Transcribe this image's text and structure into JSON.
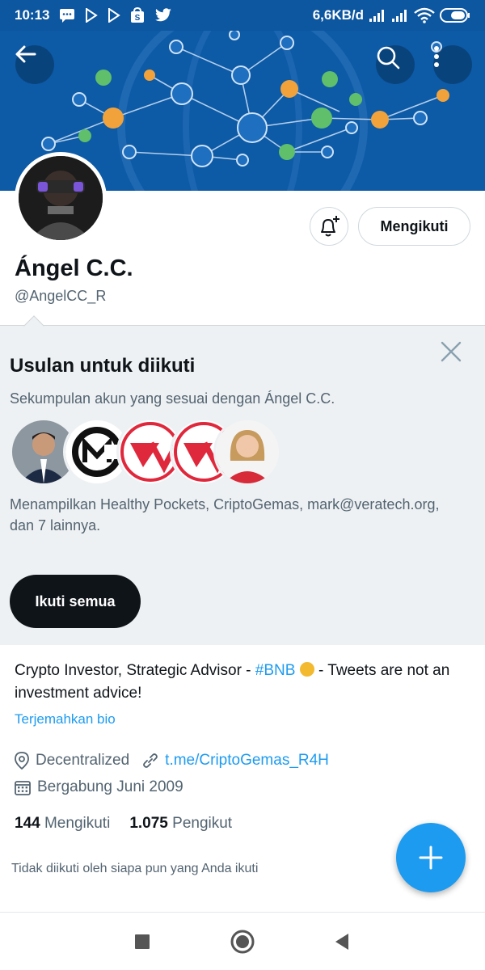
{
  "status_bar": {
    "time": "10:13",
    "network_speed": "6,6KB/d",
    "icons": [
      "chat-icon",
      "play-store-icon",
      "play-icon",
      "shop-icon",
      "twitter-icon",
      "signal-icon",
      "signal-icon",
      "wifi-icon",
      "battery-icon"
    ]
  },
  "header": {
    "back_icon": "arrow-left-icon",
    "search_icon": "search-icon",
    "more_icon": "more-vertical-icon"
  },
  "profile": {
    "display_name": "Ángel C.C.",
    "handle": "@AngelCC_R",
    "follow_button_label": "Mengikuti",
    "bell_icon": "bell-plus-icon"
  },
  "suggestions": {
    "title": "Usulan untuk diikuti",
    "subtitle": "Sekumpulan akun yang sesuai dengan Ángel C.C.",
    "description": "Menampilkan Healthy Pockets, CriptoGemas, mark@veratech.org, dan 7 lainnya.",
    "follow_all_label": "Ikuti semua",
    "avatars": [
      "man-in-suit",
      "cripto-gemas-logo",
      "veratech-logo",
      "veratech-logo",
      "woman-in-red"
    ]
  },
  "bio": {
    "text_before": "Crypto Investor, Strategic Advisor - ",
    "hashtag": "#BNB",
    "text_after": " - Tweets are not an investment advice!",
    "translate_label": "Terjemahkan bio",
    "location": "Decentralized",
    "website": "t.me/CriptoGemas_R4H",
    "joined": "Bergabung Juni 2009"
  },
  "counts": {
    "following_count": "144",
    "following_label": "Mengikuti",
    "followers_count": "1.075",
    "followers_label": "Pengikut"
  },
  "not_followed_text": "Tidak diikuti oleh siapa pun yang Anda ikuti",
  "colors": {
    "accent": "#1d9bf0",
    "banner": "#0d5aa6",
    "status_bar": "#0d56a0"
  }
}
